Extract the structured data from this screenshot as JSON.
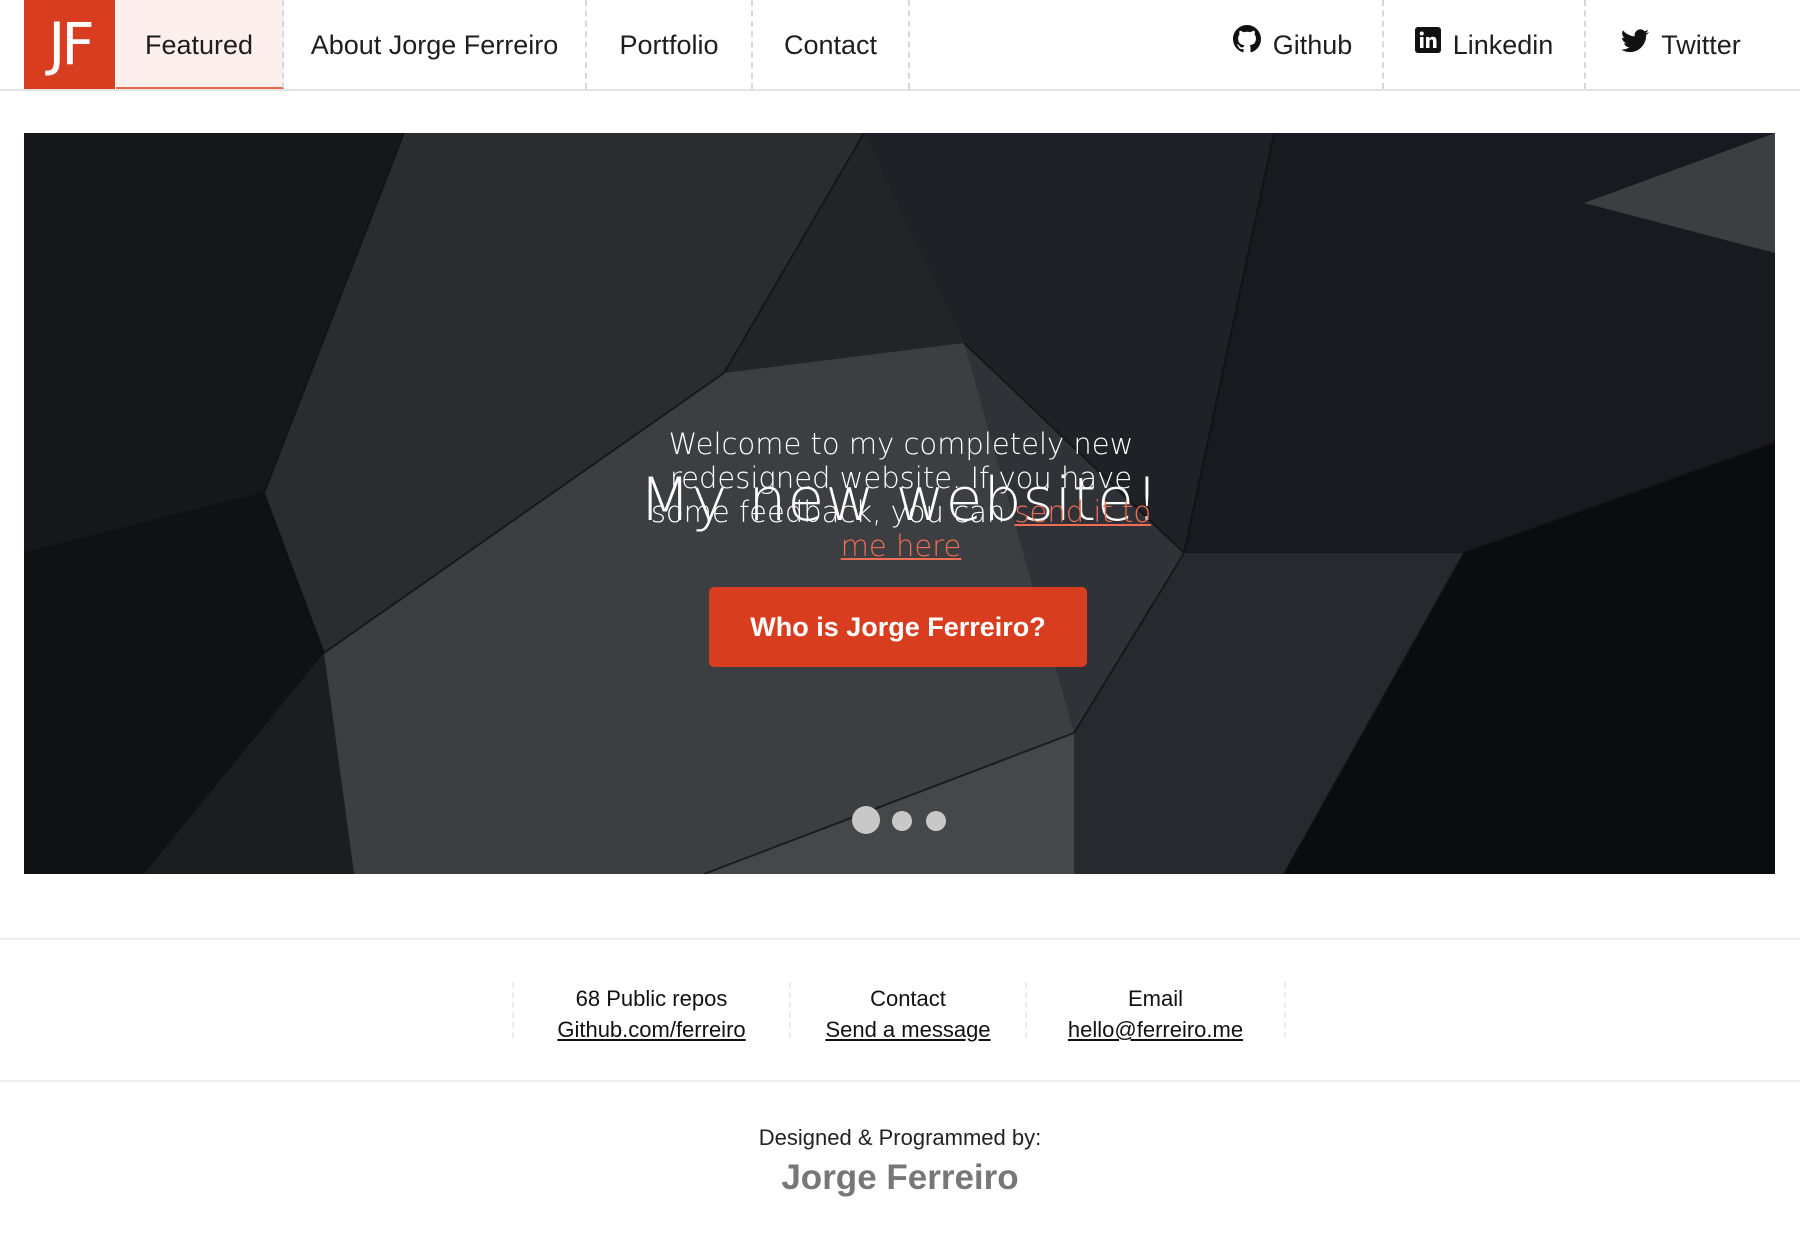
{
  "nav": {
    "logo": "JF",
    "items": [
      {
        "label": "Featured",
        "active": true
      },
      {
        "label": "About Jorge Ferreiro",
        "active": false
      },
      {
        "label": "Portfolio",
        "active": false
      },
      {
        "label": "Contact",
        "active": false
      }
    ],
    "social": [
      {
        "label": "Github",
        "icon": "github-icon"
      },
      {
        "label": "Linkedin",
        "icon": "linkedin-icon"
      },
      {
        "label": "Twitter",
        "icon": "twitter-icon"
      }
    ]
  },
  "hero": {
    "title": "My new website!",
    "text_before_link": "Welcome to my completely new redesigned website. If you have some feedback, you can ",
    "link_text": "send it to me here",
    "cta_label": "Who is Jorge Ferreiro?",
    "slides_total": 3,
    "slide_active": 1
  },
  "stats": [
    {
      "label": "68 Public repos",
      "link": "Github.com/ferreiro"
    },
    {
      "label": "Contact",
      "link": "Send a message"
    },
    {
      "label": "Email",
      "link": "hello@ferreiro.me"
    }
  ],
  "footer": {
    "credit_label": "Designed & Programmed by:",
    "credit_name": "Jorge Ferreiro"
  },
  "colors": {
    "accent": "#d83d1f",
    "link_on_dark": "#ef6e55",
    "active_nav_bg": "#fdf0ec"
  }
}
